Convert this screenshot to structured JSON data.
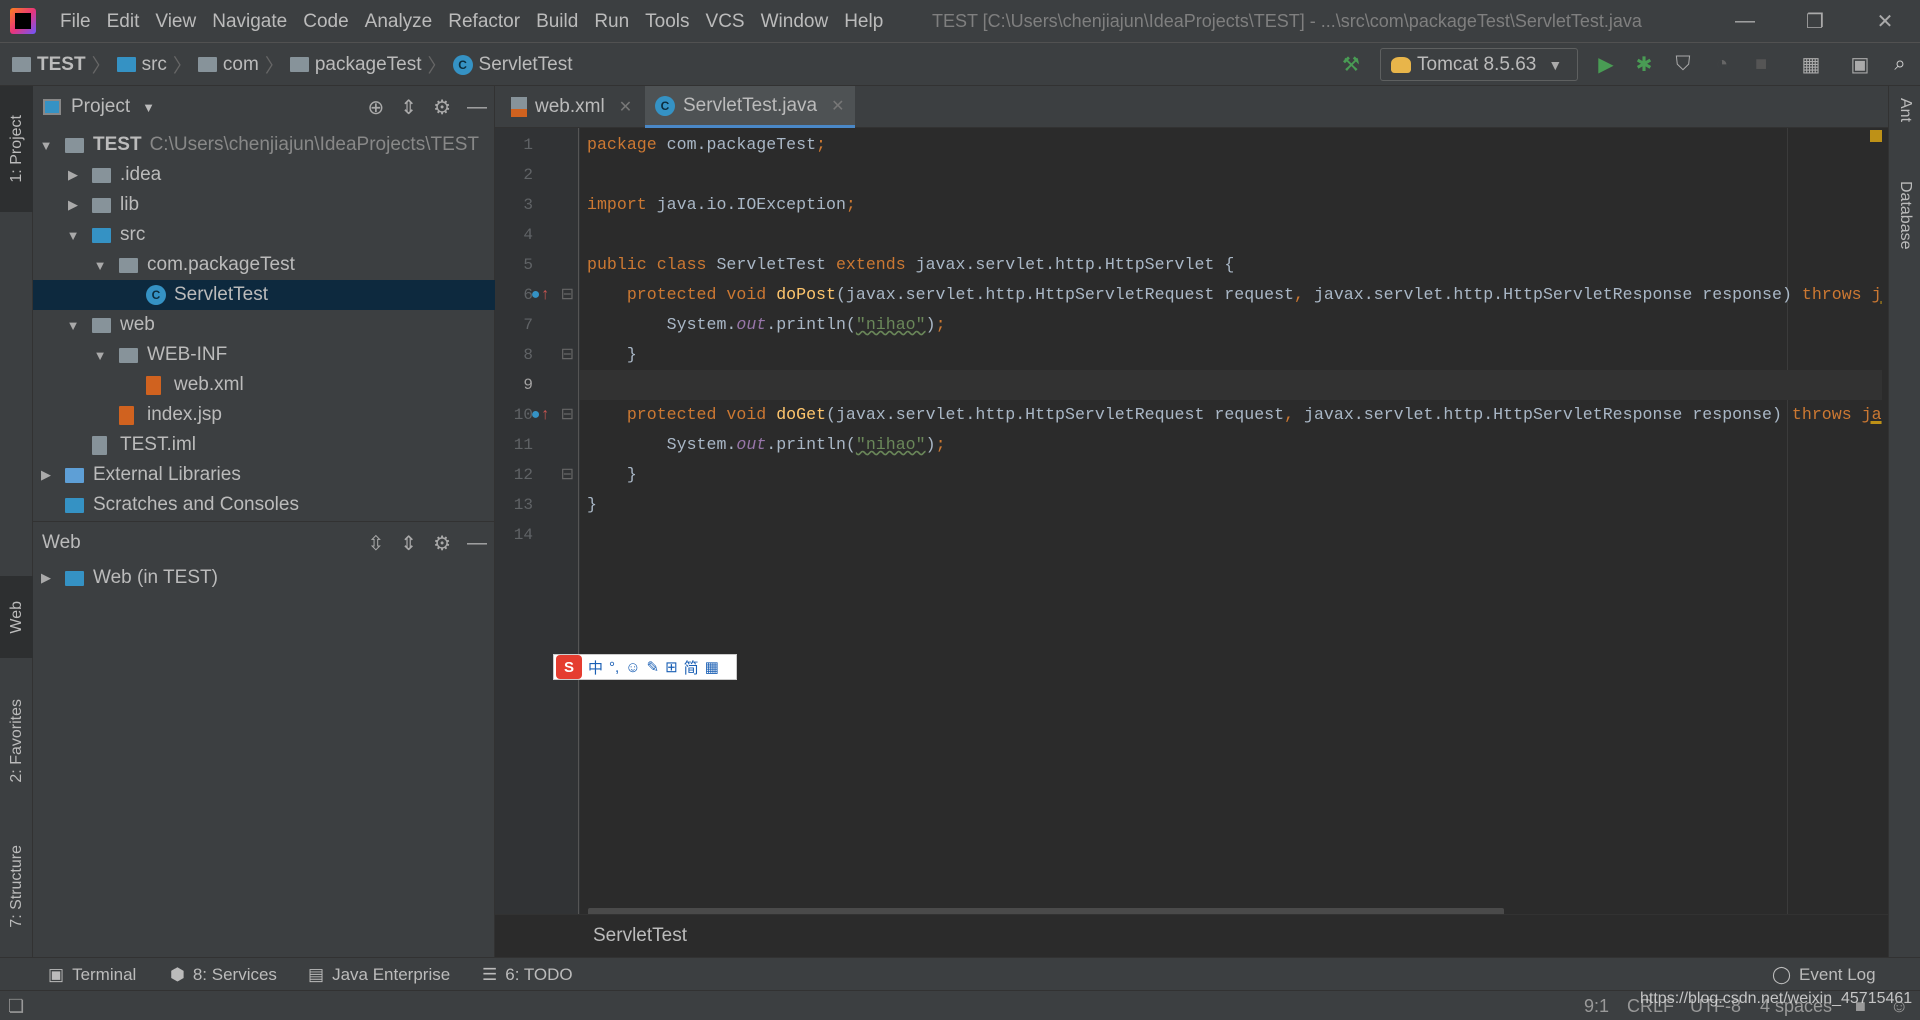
{
  "menu": [
    "File",
    "Edit",
    "View",
    "Navigate",
    "Code",
    "Analyze",
    "Refactor",
    "Build",
    "Run",
    "Tools",
    "VCS",
    "Window",
    "Help"
  ],
  "window_title": "TEST [C:\\Users\\chenjiajun\\IdeaProjects\\TEST] - ...\\src\\com\\packageTest\\ServletTest.java",
  "breadcrumbs": [
    "TEST",
    "src",
    "com",
    "packageTest",
    "ServletTest"
  ],
  "run_config": "Tomcat 8.5.63",
  "colors": {
    "accent": "#3592c4",
    "run": "#499c54",
    "selection": "#0d293e"
  },
  "left_stripe": [
    "1: Project",
    "Web",
    "2: Favorites",
    "7: Structure"
  ],
  "right_stripe": [
    "Ant",
    "Database"
  ],
  "project": {
    "header": "Project",
    "tree": [
      {
        "label": "TEST",
        "path": "C:\\Users\\chenjiajun\\IdeaProjects\\TEST",
        "depth": 0,
        "open": true,
        "icon": "module"
      },
      {
        "label": ".idea",
        "depth": 1,
        "open": false,
        "icon": "folder"
      },
      {
        "label": "lib",
        "depth": 1,
        "open": false,
        "icon": "folder"
      },
      {
        "label": "src",
        "depth": 1,
        "open": true,
        "icon": "source-folder"
      },
      {
        "label": "com.packageTest",
        "depth": 2,
        "open": true,
        "icon": "package"
      },
      {
        "label": "ServletTest",
        "depth": 3,
        "icon": "class",
        "selected": true
      },
      {
        "label": "web",
        "depth": 1,
        "open": true,
        "icon": "web-folder"
      },
      {
        "label": "WEB-INF",
        "depth": 2,
        "open": true,
        "icon": "folder"
      },
      {
        "label": "web.xml",
        "depth": 3,
        "icon": "xml"
      },
      {
        "label": "index.jsp",
        "depth": 2,
        "icon": "jsp"
      },
      {
        "label": "TEST.iml",
        "depth": 1,
        "icon": "iml"
      },
      {
        "label": "External Libraries",
        "depth": 0,
        "open": false,
        "icon": "libraries"
      },
      {
        "label": "Scratches and Consoles",
        "depth": 0,
        "icon": "scratches"
      }
    ]
  },
  "web": {
    "header": "Web",
    "item": "Web (in TEST)"
  },
  "tabs": [
    {
      "label": "web.xml",
      "active": false
    },
    {
      "label": "ServletTest.java",
      "active": true
    }
  ],
  "current_line": 9,
  "code": [
    [
      [
        "package",
        "kw"
      ],
      [
        " com.packageTest",
        "pl"
      ],
      [
        ";",
        "pu"
      ]
    ],
    [],
    [
      [
        "import",
        "kw"
      ],
      [
        " java.io.IOException",
        "pl"
      ],
      [
        ";",
        "pu"
      ]
    ],
    [],
    [
      [
        "public class ",
        "kw"
      ],
      [
        "ServletTest ",
        "pl"
      ],
      [
        "extends ",
        "kw"
      ],
      [
        "javax.servlet.http.HttpServlet {",
        "pl"
      ]
    ],
    [
      [
        "    protected void ",
        "kw"
      ],
      [
        "doPost",
        "fn"
      ],
      [
        "(javax.servlet.http.HttpServletRequest request",
        "pl"
      ],
      [
        ", ",
        "pu"
      ],
      [
        "javax.servlet.http.HttpServletResponse response) ",
        "pl"
      ],
      [
        "throws ",
        "kw"
      ],
      [
        "j",
        "th"
      ]
    ],
    [
      [
        "        System.",
        "pl"
      ],
      [
        "out",
        "it"
      ],
      [
        ".println(",
        "pl"
      ],
      [
        "\"nihao\"",
        "st"
      ],
      [
        ")",
        "pl"
      ],
      [
        ";",
        "pu"
      ]
    ],
    [
      [
        "    }",
        "pl"
      ]
    ],
    [],
    [
      [
        "    protected void ",
        "kw"
      ],
      [
        "doGet",
        "fn"
      ],
      [
        "(javax.servlet.http.HttpServletRequest request",
        "pl"
      ],
      [
        ", ",
        "pu"
      ],
      [
        "javax.servlet.http.HttpServletResponse response) ",
        "pl"
      ],
      [
        "throws ",
        "kw"
      ],
      [
        "ja",
        "th"
      ]
    ],
    [
      [
        "        System.",
        "pl"
      ],
      [
        "out",
        "it"
      ],
      [
        ".println(",
        "pl"
      ],
      [
        "\"nihao\"",
        "st"
      ],
      [
        ")",
        "pl"
      ],
      [
        ";",
        "pu"
      ]
    ],
    [
      [
        "    }",
        "pl"
      ]
    ],
    [
      [
        "}",
        "pl"
      ]
    ],
    []
  ],
  "editor_breadcrumb": "ServletTest",
  "bottom_tools": [
    "Terminal",
    "8: Services",
    "Java Enterprise",
    "6: TODO"
  ],
  "event_log": "Event Log",
  "status": {
    "position": "9:1",
    "line_sep": "CRLF",
    "encoding": "UTF-8",
    "indent": "4 spaces"
  },
  "ime": [
    "中",
    "°,",
    "☺",
    "✎",
    "⊞",
    "简",
    "▦"
  ],
  "watermark": "https://blog.csdn.net/weixin_45715461"
}
